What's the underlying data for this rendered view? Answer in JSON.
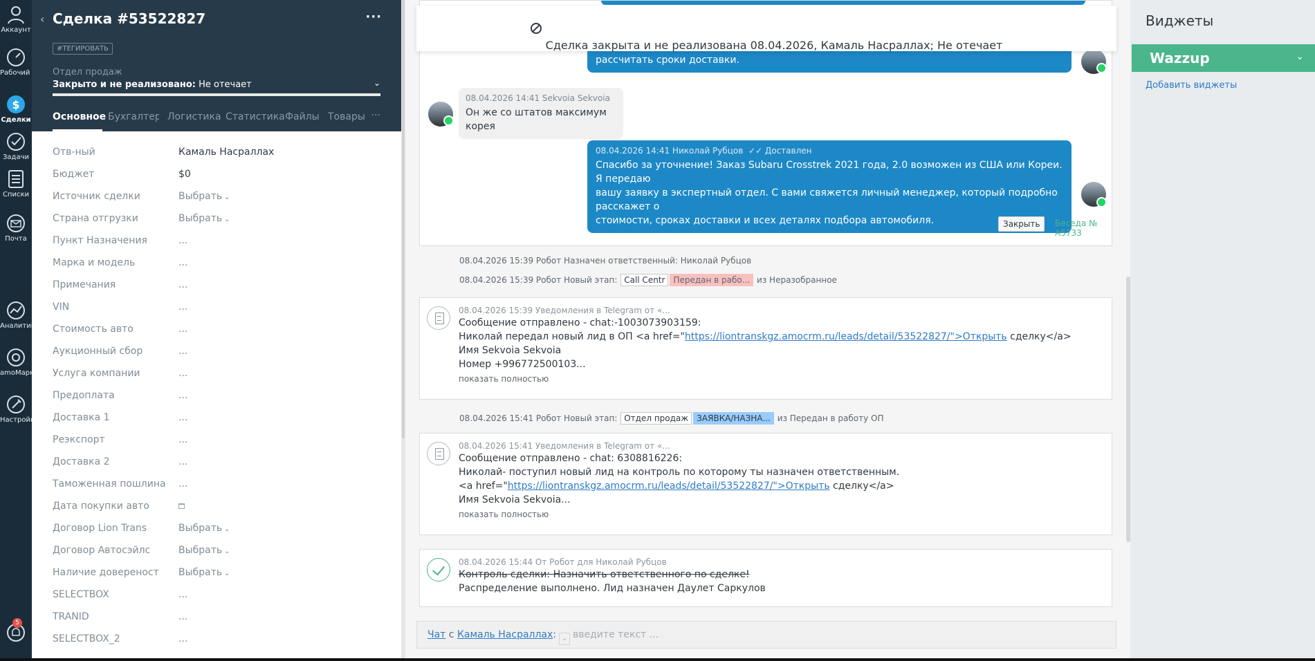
{
  "rail": {
    "items": [
      {
        "label": "Аккаунт",
        "icon": "account-icon"
      },
      {
        "label": "Рабочий стол",
        "icon": "dashboard-icon"
      },
      {
        "label": "Сделки",
        "icon": "leads-icon"
      },
      {
        "label": "Задачи",
        "icon": "tasks-icon"
      },
      {
        "label": "Списки",
        "icon": "lists-icon"
      },
      {
        "label": "Почта",
        "icon": "mail-icon"
      },
      {
        "label": "Аналитика",
        "icon": "analytics-icon"
      },
      {
        "label": "amoМаркет",
        "icon": "market-icon"
      },
      {
        "label": "Настройки",
        "icon": "settings-icon"
      }
    ],
    "notifications_count": "5"
  },
  "card": {
    "title": "Сделка #53522827",
    "tag_button": "#ТЕГИРОВАТЬ",
    "pipeline_label": "Отдел продаж",
    "status_bold": "Закрыто и не реализовано:",
    "status_reason": " Не отечает",
    "tabs": [
      "Основное",
      "Бухгалтерия",
      "Логистика",
      "Статистика",
      "Файлы",
      "Товары"
    ],
    "fields": [
      {
        "key": "Отв-ный",
        "value": "Камаль Насраллах"
      },
      {
        "key": "Бюджет",
        "value": "$0"
      },
      {
        "key": "Источник сделки",
        "value": "Выбрать"
      },
      {
        "key": "Страна отгрузки",
        "value": "Выбрать"
      },
      {
        "key": "Пункт Назначения",
        "value": "..."
      },
      {
        "key": "Марка и модель",
        "value": "..."
      },
      {
        "key": "Примечания",
        "value": "..."
      },
      {
        "key": "VIN",
        "value": "..."
      },
      {
        "key": "Стоимость авто",
        "value": "..."
      },
      {
        "key": "Аукционный сбор",
        "value": "..."
      },
      {
        "key": "Услуга компании",
        "value": "..."
      },
      {
        "key": "Предоплата",
        "value": "..."
      },
      {
        "key": "Доставка 1",
        "value": "..."
      },
      {
        "key": "Реэкспорт",
        "value": "..."
      },
      {
        "key": "Доставка 2",
        "value": "..."
      },
      {
        "key": "Таможенная пошлина",
        "value": "..."
      },
      {
        "key": "Дата покупки авто",
        "value": ""
      },
      {
        "key": "Договор Lion Trans",
        "value": "Выбрать"
      },
      {
        "key": "Договор Автосэйлс",
        "value": "Выбрать"
      },
      {
        "key": "Наличие довереност",
        "value": "Выбрать"
      },
      {
        "key": "SELECTBOX",
        "value": "..."
      },
      {
        "key": "TRANID",
        "value": "..."
      },
      {
        "key": "SELECTBOX_2",
        "value": "..."
      }
    ]
  },
  "feed": {
    "closed_banner": "Сделка закрыта и не реализована 08.04.2026, Камаль Насраллах; Не отечает",
    "msg1_text": "рассчитать сроки доставки.",
    "msg2": {
      "meta": "08.04.2026 14:41 Sekvoia Sekvoia",
      "text": "Он же со штатов максимум корея"
    },
    "msg3": {
      "meta": "08.04.2026 14:41 Николай Рубцов",
      "status": "✓✓ Доставлен",
      "lines": [
        "Спасибо за уточнение! Заказ Subaru Crosstrek 2021 года, 2.0 возможен из США или Кореи. Я передаю",
        "вашу заявку в экспертный отдел. С вами свяжется личный менеджер, который подробно расскажет о",
        "стоимости, сроках доставки и всех деталях подбора автомобиля."
      ]
    },
    "close_button": "Закрыть",
    "conversation_link": "Беседа № A5733",
    "sys1": "08.04.2026 15:39 Робот Назначен ответственный: Николай Рубцов",
    "sys2": {
      "prefix": "08.04.2026 15:39 Робот Новый этап:",
      "pill1": "Call Centr",
      "pill2": "Передан в рабо...",
      "suffix": "из Неразобранное"
    },
    "note1": {
      "meta": "08.04.2026 15:39 Уведомления в Telegram от «...",
      "line1": "Сообщение отправлено - chat:-1003073903159:",
      "line2_pre": "Николай передал новый лид в ОП <a href=\"",
      "line2_link": "https://liontranskgz.amocrm.ru/leads/detail/53522827/\">Открыть",
      "line2_post": " сделку</a>",
      "line3": "Имя Sekvoia Sekvoia",
      "line4": "Номер +996772500103...",
      "more": "показать полностью"
    },
    "sys3": {
      "prefix": "08.04.2026 15:41 Робот Новый этап:",
      "pill1": "Отдел продаж",
      "pill2": "ЗАЯВКА/НАЗНА...",
      "suffix": "из Передан в работу ОП"
    },
    "note2": {
      "meta": "08.04.2026 15:41 Уведомления в Telegram от «...",
      "line1": "Сообщение отправлено - chat: 6308816226:",
      "line2": "Николай- поступил новый лид на контроль по которому ты назначен ответственным.",
      "line3_pre": "<a href=\"",
      "line3_link": "https://liontranskgz.amocrm.ru/leads/detail/53522827/\">Открыть",
      "line3_post": " сделку</a>",
      "line4": "Имя Sekvoia Sekvoia...",
      "more": "показать полностью"
    },
    "task": {
      "meta": "08.04.2026 15:44  От Робот для Николай Рубцов",
      "title": "Контроль сделки: Назначить ответственного по сделке!",
      "result": "Распределение выполнено. Лид назначен Даулет Саркулов"
    },
    "composer": {
      "chat_link": "Чат",
      "with": " с ",
      "contact_link": "Камаль Насраллах",
      "colon": ":",
      "placeholder": "введите текст ..."
    }
  },
  "widgets": {
    "title": "Виджеты",
    "wazzup": "Wazzup",
    "add": "Добавить виджеты"
  },
  "colors": {
    "accent_blue": "#1d88c6",
    "green": "#4bb58b",
    "sidebar_dark": "#1a2c3a",
    "card_header": "#273a49"
  }
}
